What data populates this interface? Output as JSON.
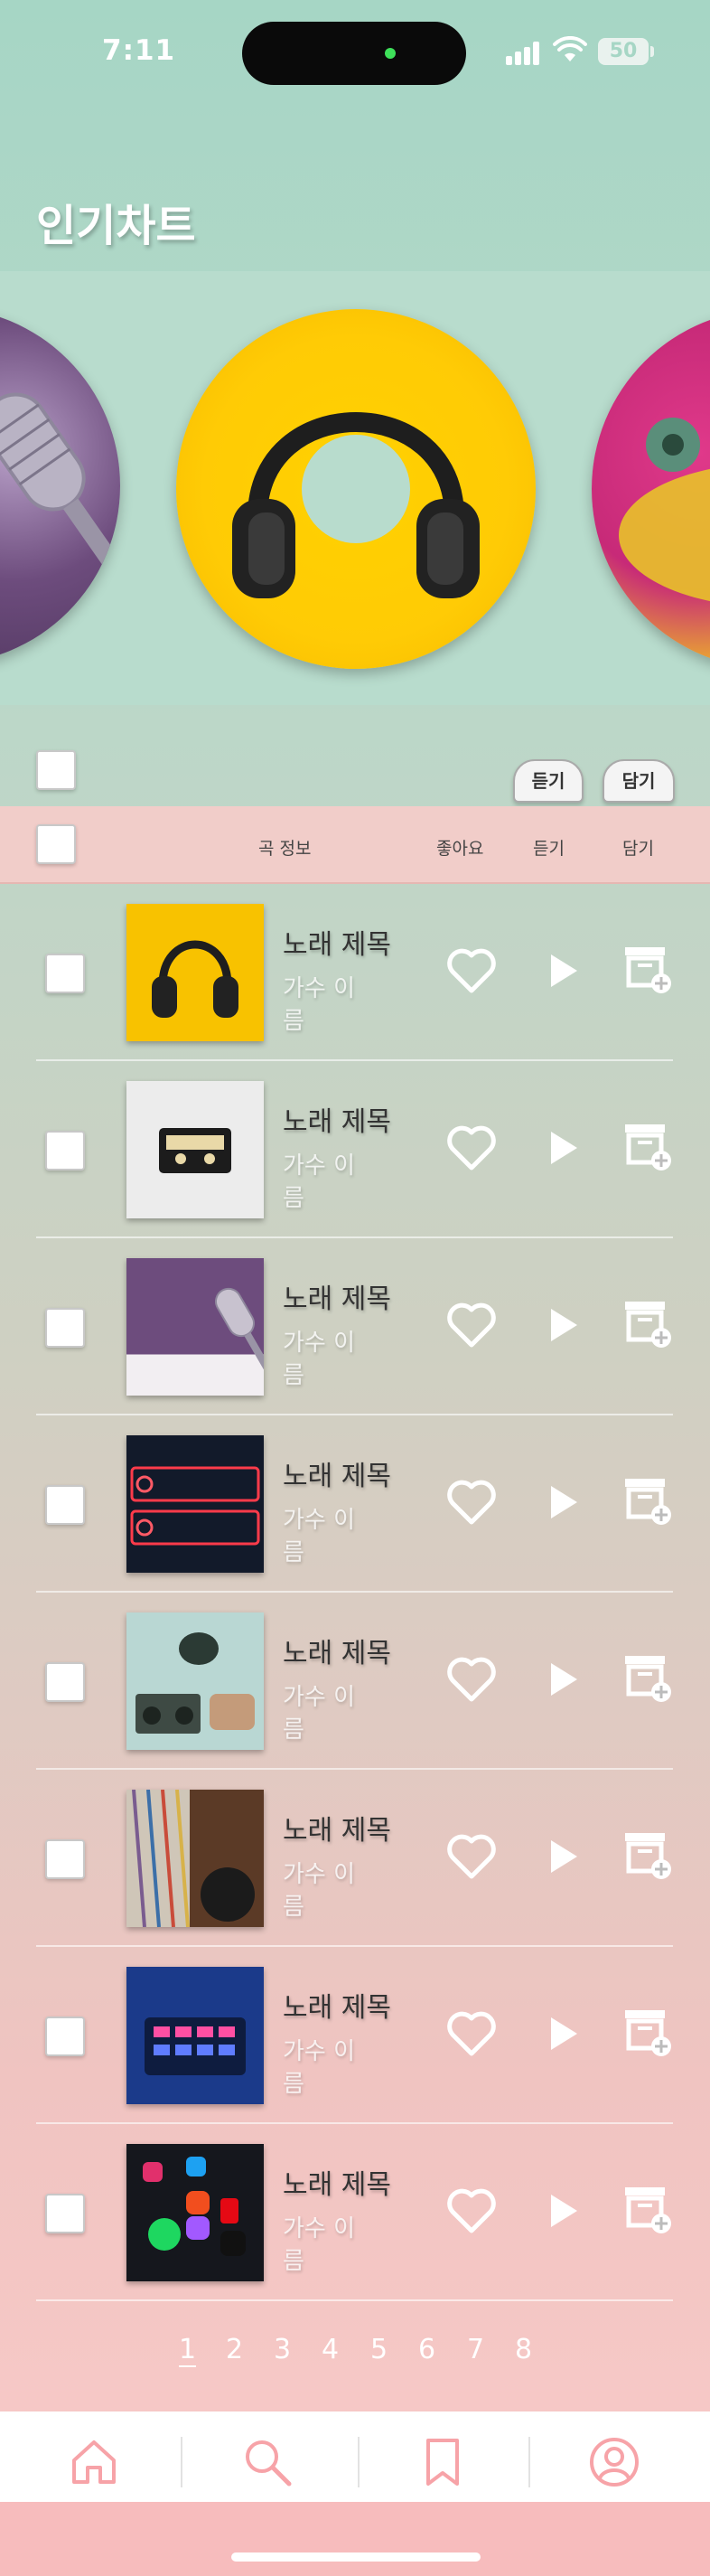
{
  "status_bar": {
    "time": "7:11",
    "battery": "50"
  },
  "page": {
    "title": "인기차트"
  },
  "carousel": {
    "covers": [
      "microphone",
      "headphones",
      "vinyl-record"
    ]
  },
  "actions": {
    "listen": "듣기",
    "save": "담기"
  },
  "table": {
    "headers": {
      "song_info": "곡 정보",
      "like": "좋아요",
      "listen": "듣기",
      "save": "담기"
    },
    "rows": [
      {
        "title": "노래 제목",
        "artist": "가수 이름",
        "cover": "headphones"
      },
      {
        "title": "노래 제목",
        "artist": "가수 이름",
        "cover": "cassette"
      },
      {
        "title": "노래 제목",
        "artist": "가수 이름",
        "cover": "microphone"
      },
      {
        "title": "노래 제목",
        "artist": "가수 이름",
        "cover": "neon-sign"
      },
      {
        "title": "노래 제목",
        "artist": "가수 이름",
        "cover": "boombox"
      },
      {
        "title": "노래 제목",
        "artist": "가수 이름",
        "cover": "records"
      },
      {
        "title": "노래 제목",
        "artist": "가수 이름",
        "cover": "launchpad"
      },
      {
        "title": "노래 제목",
        "artist": "가수 이름",
        "cover": "app-icons"
      }
    ]
  },
  "pagination": {
    "pages": [
      "1",
      "2",
      "3",
      "4",
      "5",
      "6",
      "7",
      "8"
    ],
    "current": "1"
  },
  "bottom_nav": {
    "items": [
      "home-icon",
      "search-icon",
      "bookmark-icon",
      "profile-icon"
    ]
  },
  "colors": {
    "mint": "#a6d6c5",
    "pink": "#f6c8c6",
    "accent_pink": "#f7a3a8"
  }
}
